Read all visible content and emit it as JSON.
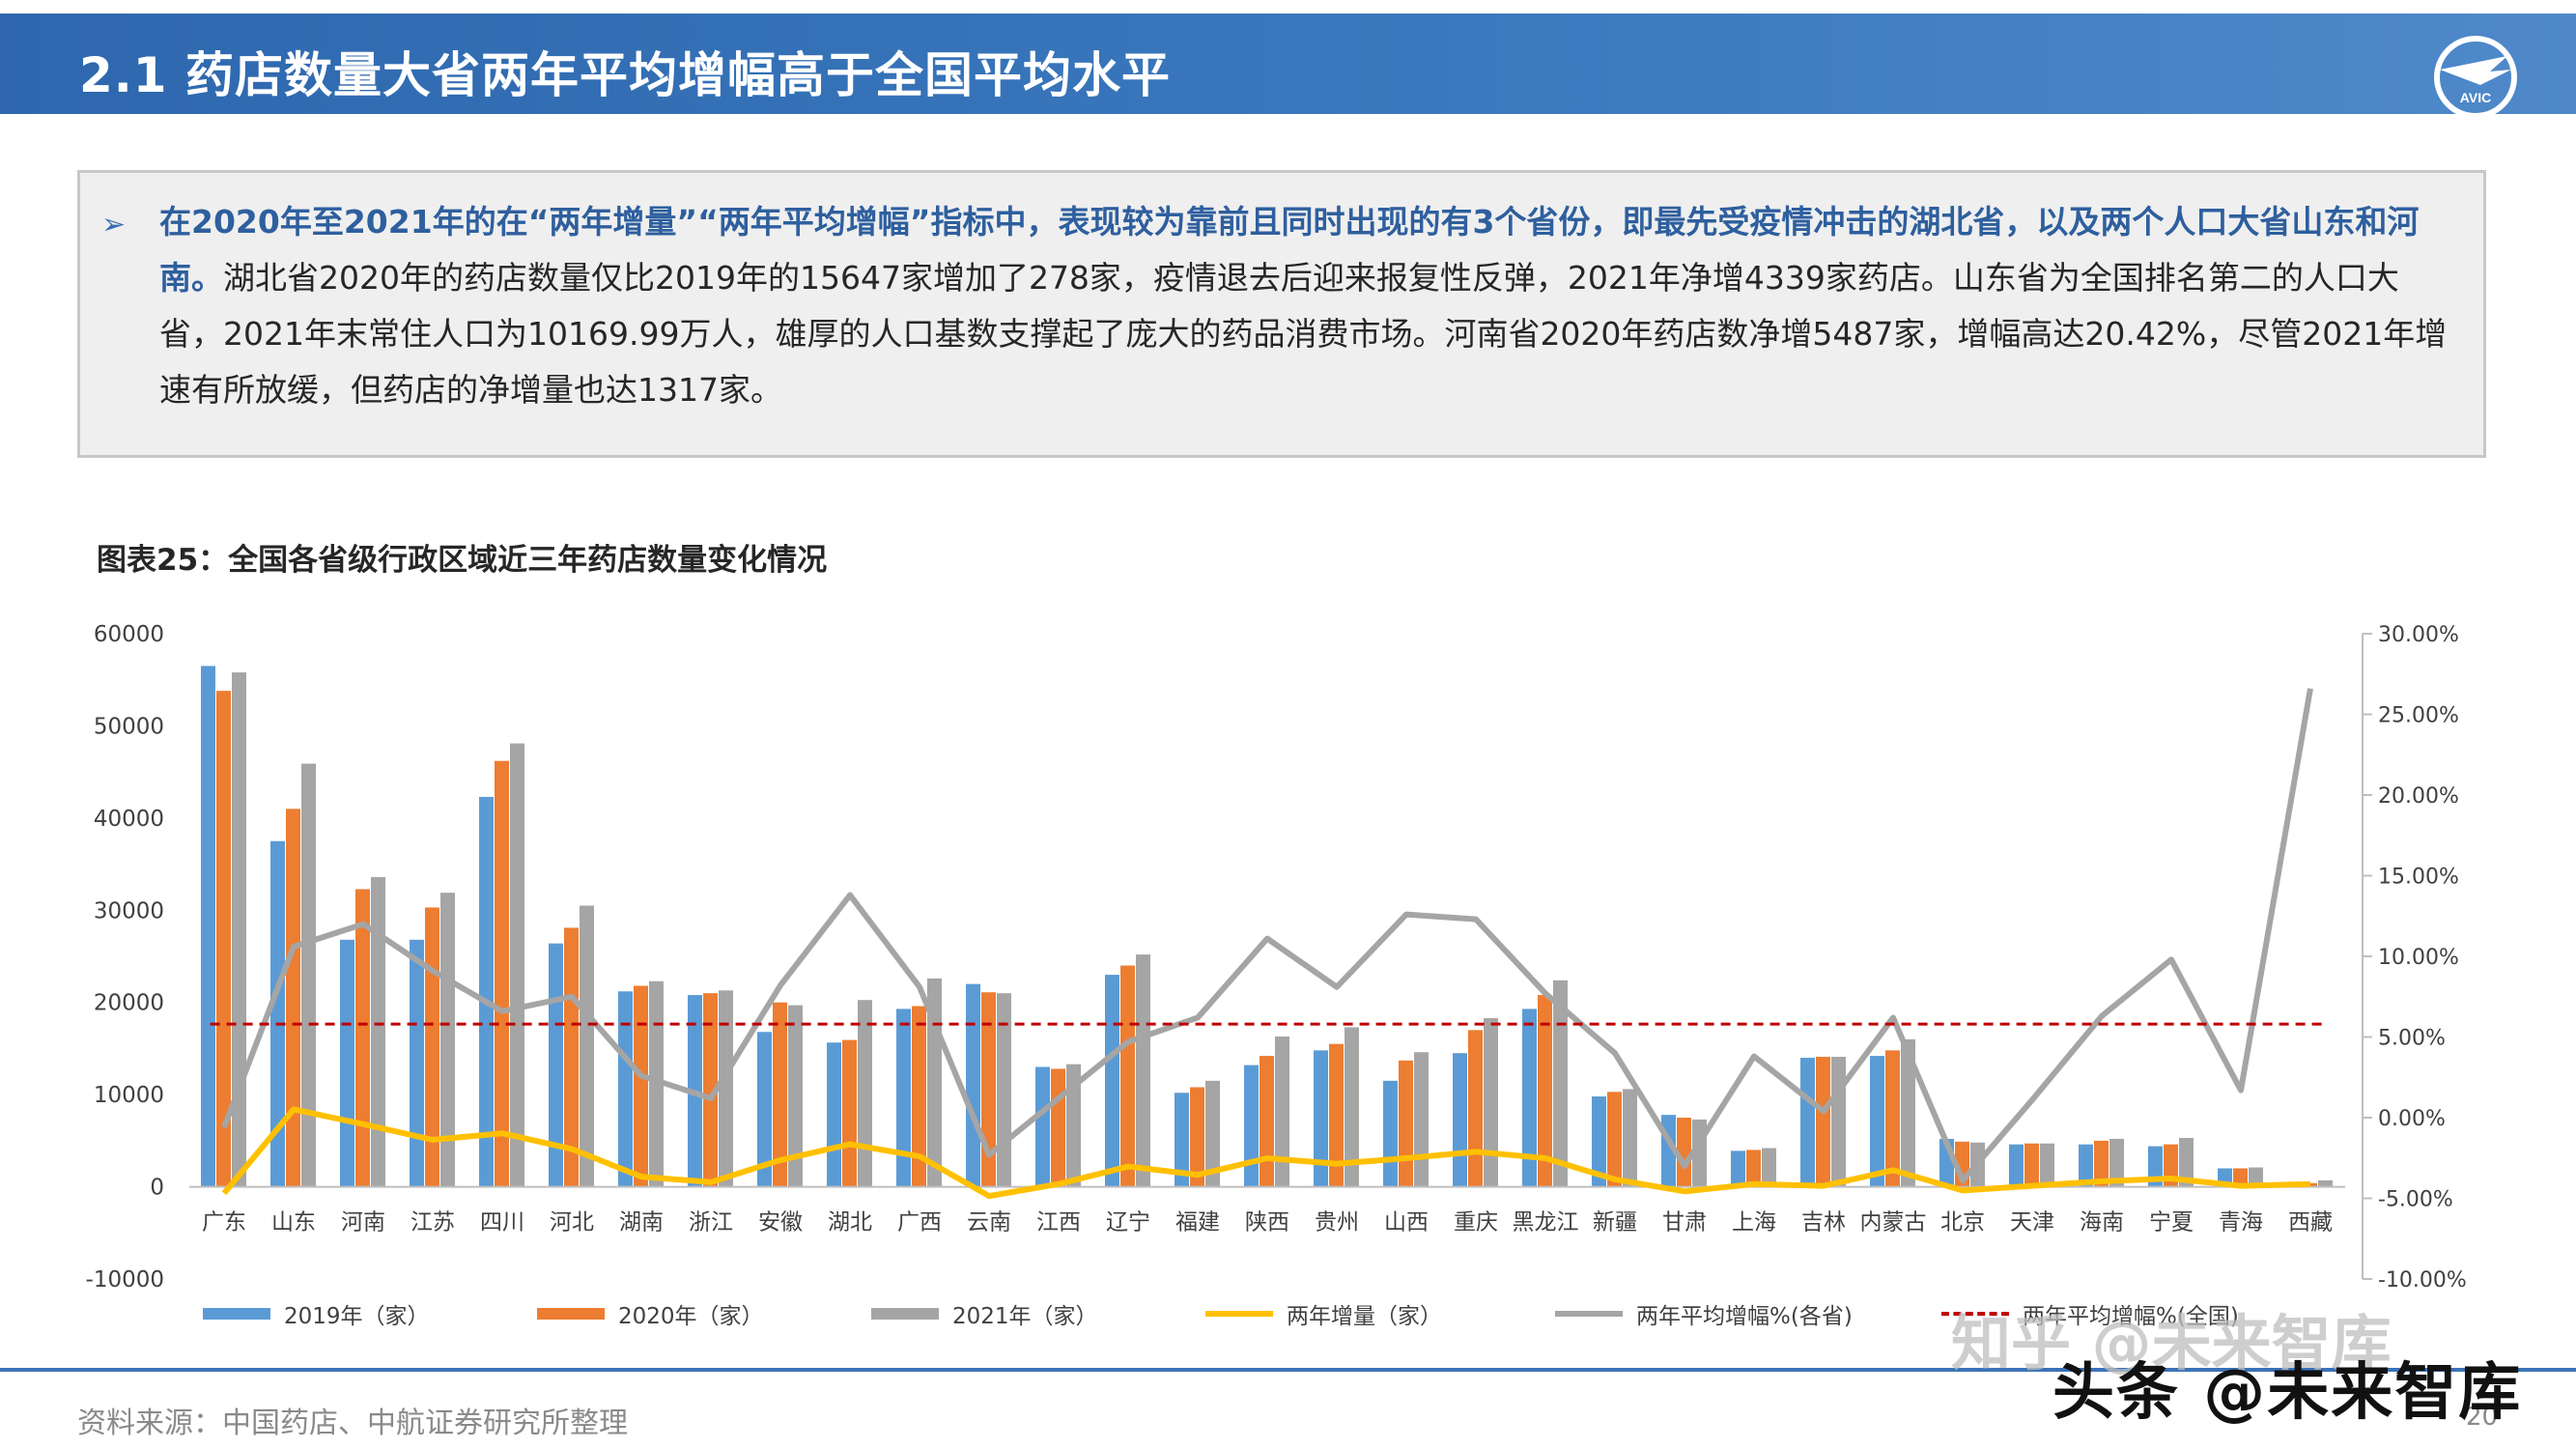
{
  "header": {
    "title": "2.1 药店数量大省两年平均增幅高于全国平均水平",
    "logo_text": "AVIC"
  },
  "summary": {
    "bullet": "➢",
    "bold": "在2020年至2021年的在“两年增量”“两年平均增幅”指标中，表现较为靠前且同时出现的有3个省份，即最先受疫情冲击的湖北省，以及两个人口大省山东和河南。",
    "text": "湖北省2020年的药店数量仅比2019年的15647家增加了278家，疫情退去后迎来报复性反弹，2021年净增4339家药店。山东省为全国排名第二的人口大省，2021年末常住人口为10169.99万人，雄厚的人口基数支撑起了庞大的药品消费市场。河南省2020年药店数净增5487家，增幅高达20.42%，尽管2021年增速有所放缓，但药店的净增量也达1317家。"
  },
  "figure": {
    "title": "图表25：全国各省级行政区域近三年药店数量变化情况"
  },
  "colors": {
    "y2019": "#5b9bd5",
    "y2020": "#ed7d31",
    "y2021": "#a5a5a5",
    "increase": "#ffc000",
    "avg_growth": "#a5a5a5",
    "national_avg": "#c00000"
  },
  "chart_data": {
    "type": "bar",
    "categories": [
      "广东",
      "山东",
      "河南",
      "江苏",
      "四川",
      "河北",
      "湖南",
      "浙江",
      "安徽",
      "湖北",
      "广西",
      "云南",
      "江西",
      "辽宁",
      "福建",
      "陕西",
      "贵州",
      "山西",
      "重庆",
      "黑龙江",
      "新疆",
      "甘肃",
      "上海",
      "吉林",
      "内蒙古",
      "北京",
      "天津",
      "海南",
      "宁夏",
      "青海",
      "西藏"
    ],
    "series": [
      {
        "name": "2019年（家）",
        "type": "bar",
        "axis": "left",
        "values": [
          56500,
          37500,
          26800,
          26800,
          42300,
          26400,
          21200,
          20800,
          16800,
          15647,
          19300,
          22000,
          13000,
          23000,
          10200,
          13200,
          14800,
          11500,
          14500,
          19300,
          9800,
          7800,
          3900,
          14000,
          14200,
          5200,
          4600,
          4600,
          4400,
          2000,
          400
        ]
      },
      {
        "name": "2020年（家）",
        "type": "bar",
        "axis": "left",
        "values": [
          53800,
          41000,
          32287,
          30300,
          46200,
          28100,
          21800,
          21000,
          20000,
          15925,
          19600,
          21100,
          12800,
          24000,
          10800,
          14200,
          15500,
          13700,
          17000,
          20800,
          10300,
          7500,
          4000,
          14100,
          14800,
          4900,
          4700,
          5000,
          4600,
          2000,
          400
        ]
      },
      {
        "name": "2021年（家）",
        "type": "bar",
        "axis": "left",
        "values": [
          55800,
          45900,
          33604,
          31900,
          48100,
          30500,
          22300,
          21300,
          19700,
          20264,
          22600,
          21000,
          13300,
          25200,
          11500,
          16300,
          17300,
          14600,
          18300,
          22400,
          10600,
          7300,
          4200,
          14100,
          16000,
          4800,
          4700,
          5200,
          5300,
          2100,
          700
        ]
      },
      {
        "name": "两年增量（家）",
        "type": "line",
        "axis": "left",
        "values": [
          -700,
          8400,
          6800,
          5100,
          5800,
          4100,
          1100,
          500,
          2900,
          4617,
          3300,
          -1000,
          300,
          2200,
          1300,
          3100,
          2500,
          3100,
          3800,
          3100,
          800,
          -500,
          300,
          100,
          1800,
          -400,
          100,
          600,
          900,
          100,
          300
        ]
      },
      {
        "name": "两年平均增幅%(各省)",
        "type": "line",
        "axis": "right",
        "values": [
          -0.6,
          10.6,
          12.0,
          9.1,
          6.6,
          7.5,
          2.6,
          1.2,
          8.2,
          13.8,
          8.1,
          -2.3,
          1.2,
          4.7,
          6.2,
          11.1,
          8.1,
          12.6,
          12.3,
          7.7,
          4.0,
          -3.0,
          3.8,
          0.4,
          6.2,
          -3.9,
          1.1,
          6.3,
          9.8,
          1.7,
          26.6
        ]
      },
      {
        "name": "两年平均增幅%(全国)",
        "type": "line",
        "axis": "right",
        "dashed": true,
        "values": [
          5.8,
          5.8,
          5.8,
          5.8,
          5.8,
          5.8,
          5.8,
          5.8,
          5.8,
          5.8,
          5.8,
          5.8,
          5.8,
          5.8,
          5.8,
          5.8,
          5.8,
          5.8,
          5.8,
          5.8,
          5.8,
          5.8,
          5.8,
          5.8,
          5.8,
          5.8,
          5.8,
          5.8,
          5.8,
          5.8,
          5.8
        ]
      }
    ],
    "ylim": [
      -10000,
      60000
    ],
    "y_ticks": [
      "-10000",
      "0",
      "10000",
      "20000",
      "30000",
      "40000",
      "50000",
      "60000"
    ],
    "y2lim": [
      -10,
      30
    ],
    "y2_ticks": [
      "-10.00%",
      "-5.00%",
      "0.00%",
      "5.00%",
      "10.00%",
      "15.00%",
      "20.00%",
      "25.00%",
      "30.00%"
    ],
    "legend_position": "bottom",
    "grid": false
  },
  "source": "资料来源：中国药店、中航证券研究所整理",
  "page_number": "20",
  "watermark": {
    "line1": "知乎 @未来智库",
    "line2": "头条 @未来智库"
  }
}
